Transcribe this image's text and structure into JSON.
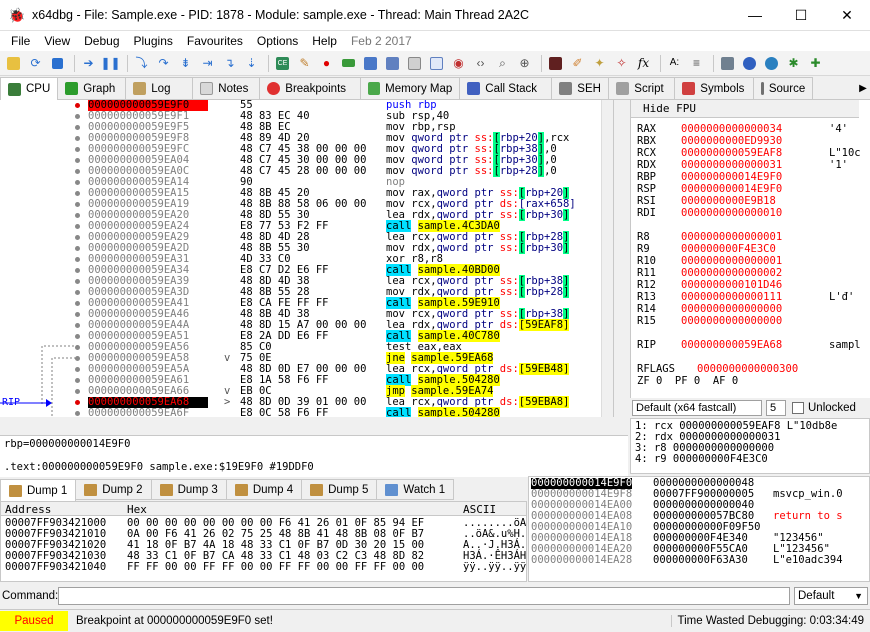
{
  "window": {
    "title": "x64dbg - File: Sample.exe - PID: 1878 - Module: sample.exe - Thread: Main Thread 2A2C",
    "minimize_glyph": "—",
    "maximize_glyph": "☐",
    "close_glyph": "✕"
  },
  "menu": {
    "items": [
      "File",
      "View",
      "Debug",
      "Plugins",
      "Favourites",
      "Options",
      "Help"
    ],
    "date": "Feb 2 2017"
  },
  "toolbar": {
    "icons": [
      "open-icon",
      "restart-icon",
      "close-file-icon",
      "run-icon",
      "pause-icon",
      "step-into-icon",
      "step-over-icon",
      "execute-till-return-icon",
      "run-to-user-code-icon",
      "trace-into-icon",
      "trace-over-icon",
      "scylla-icon",
      "patch-icon",
      "breakpoint-icon",
      "memory-icon",
      "stack-icon",
      "module-icon",
      "handles-icon",
      "comments-icon",
      "labels-icon",
      "find-icon",
      "calls-icon",
      "cpuid-icon",
      "highlight-icon",
      "edit-icon",
      "hardware-icon",
      "fx-icon",
      "font-icon",
      "calculator-icon",
      "help-icon",
      "globe-icon",
      "bug-icon",
      "puzzle-icon"
    ],
    "ce_label": "CE",
    "fx_label": "fx",
    "font_label": "A:"
  },
  "tabs": [
    {
      "label": "CPU",
      "active": true,
      "color": "#3a7d3a"
    },
    {
      "label": "Graph",
      "active": false,
      "color": "#2c9c2c"
    },
    {
      "label": "Log",
      "active": false,
      "color": "#c0a060"
    },
    {
      "label": "Notes",
      "active": false,
      "color": "#d8d8d8"
    },
    {
      "label": "Breakpoints",
      "active": false,
      "color": "#e03030"
    },
    {
      "label": "Memory Map",
      "active": false,
      "color": "#4aa84a"
    },
    {
      "label": "Call Stack",
      "active": false,
      "color": "#4060c0"
    },
    {
      "label": "SEH",
      "active": false,
      "color": "#808080"
    },
    {
      "label": "Script",
      "active": false,
      "color": "#a0a0a0"
    },
    {
      "label": "Symbols",
      "active": false,
      "color": "#d04040"
    },
    {
      "label": "Source",
      "active": false,
      "color": "#707070"
    }
  ],
  "disasm": [
    {
      "addr": "000000000059E9F0",
      "mark": "",
      "bytes": "55",
      "asm": [
        [
          "push rbp",
          "push"
        ]
      ],
      "style": "bp"
    },
    {
      "addr": "000000000059E9F1",
      "mark": "",
      "bytes": "48 83 EC 40",
      "asm": [
        [
          "sub rsp,40",
          ""
        ]
      ]
    },
    {
      "addr": "000000000059E9F5",
      "mark": "",
      "bytes": "48 8B EC",
      "asm": [
        [
          "mov rbp,rsp",
          ""
        ]
      ]
    },
    {
      "addr": "000000000059E9F8",
      "mark": "",
      "bytes": "48 89 4D 20",
      "asm": [
        [
          "mov ",
          ""
        ],
        [
          "qword ptr ",
          "mem"
        ],
        [
          "ss:",
          "seg"
        ],
        [
          "[",
          "reg"
        ],
        [
          "rbp+20",
          "mem"
        ],
        [
          "]",
          "reg"
        ],
        [
          ",rcx",
          ""
        ]
      ]
    },
    {
      "addr": "000000000059E9FC",
      "mark": "",
      "bytes": "48 C7 45 38 00 00 00",
      "asm": [
        [
          "mov ",
          ""
        ],
        [
          "qword ptr ",
          "mem"
        ],
        [
          "ss:",
          "seg"
        ],
        [
          "[",
          "reg"
        ],
        [
          "rbp+38",
          "mem"
        ],
        [
          "]",
          "reg"
        ],
        [
          ",0",
          ""
        ]
      ]
    },
    {
      "addr": "000000000059EA04",
      "mark": "",
      "bytes": "48 C7 45 30 00 00 00",
      "asm": [
        [
          "mov ",
          ""
        ],
        [
          "qword ptr ",
          "mem"
        ],
        [
          "ss:",
          "seg"
        ],
        [
          "[",
          "reg"
        ],
        [
          "rbp+30",
          "mem"
        ],
        [
          "]",
          "reg"
        ],
        [
          ",0",
          ""
        ]
      ]
    },
    {
      "addr": "000000000059EA0C",
      "mark": "",
      "bytes": "48 C7 45 28 00 00 00",
      "asm": [
        [
          "mov ",
          ""
        ],
        [
          "qword ptr ",
          "mem"
        ],
        [
          "ss:",
          "seg"
        ],
        [
          "[",
          "reg"
        ],
        [
          "rbp+28",
          "mem"
        ],
        [
          "]",
          "reg"
        ],
        [
          ",0",
          ""
        ]
      ]
    },
    {
      "addr": "000000000059EA14",
      "mark": "",
      "bytes": "90",
      "asm": [
        [
          "nop",
          "nop"
        ]
      ]
    },
    {
      "addr": "000000000059EA15",
      "mark": "",
      "bytes": "48 8B 45 20",
      "asm": [
        [
          "mov rax,",
          ""
        ],
        [
          "qword ptr ",
          "mem"
        ],
        [
          "ss:",
          "seg"
        ],
        [
          "[",
          "reg"
        ],
        [
          "rbp+20",
          "mem"
        ],
        [
          "]",
          "reg"
        ]
      ]
    },
    {
      "addr": "000000000059EA19",
      "mark": "",
      "bytes": "48 8B 88 58 06 00 00",
      "asm": [
        [
          "mov rcx,",
          ""
        ],
        [
          "qword ptr ",
          "mem"
        ],
        [
          "ds:",
          "seg"
        ],
        [
          "[rax+658]",
          "mem"
        ]
      ]
    },
    {
      "addr": "000000000059EA20",
      "mark": "",
      "bytes": "48 8D 55 30",
      "asm": [
        [
          "lea rdx,",
          ""
        ],
        [
          "qword ptr ",
          "mem"
        ],
        [
          "ss:",
          "seg"
        ],
        [
          "[",
          "reg"
        ],
        [
          "rbp+30",
          "mem"
        ],
        [
          "]",
          "reg"
        ]
      ]
    },
    {
      "addr": "000000000059EA24",
      "mark": "",
      "bytes": "E8 77 53 F2 FF",
      "asm": [
        [
          "call",
          "call"
        ],
        [
          " ",
          ""
        ],
        [
          "sample.4C3DA0",
          "jaddr"
        ]
      ]
    },
    {
      "addr": "000000000059EA29",
      "mark": "",
      "bytes": "48 8D 4D 28",
      "asm": [
        [
          "lea rcx,",
          ""
        ],
        [
          "qword ptr ",
          "mem"
        ],
        [
          "ss:",
          "seg"
        ],
        [
          "[",
          "reg"
        ],
        [
          "rbp+28",
          "mem"
        ],
        [
          "]",
          "reg"
        ]
      ]
    },
    {
      "addr": "000000000059EA2D",
      "mark": "",
      "bytes": "48 8B 55 30",
      "asm": [
        [
          "mov rdx,",
          ""
        ],
        [
          "qword ptr ",
          "mem"
        ],
        [
          "ss:",
          "seg"
        ],
        [
          "[",
          "reg"
        ],
        [
          "rbp+30",
          "mem"
        ],
        [
          "]",
          "reg"
        ]
      ]
    },
    {
      "addr": "000000000059EA31",
      "mark": "",
      "bytes": "4D 33 C0",
      "asm": [
        [
          "xor r8,r8",
          ""
        ]
      ]
    },
    {
      "addr": "000000000059EA34",
      "mark": "",
      "bytes": "E8 C7 D2 E6 FF",
      "asm": [
        [
          "call",
          "call"
        ],
        [
          " ",
          ""
        ],
        [
          "sample.40BD00",
          "jaddr"
        ]
      ]
    },
    {
      "addr": "000000000059EA39",
      "mark": "",
      "bytes": "48 8D 4D 38",
      "asm": [
        [
          "lea rcx,",
          ""
        ],
        [
          "qword ptr ",
          "mem"
        ],
        [
          "ss:",
          "seg"
        ],
        [
          "[",
          "reg"
        ],
        [
          "rbp+38",
          "mem"
        ],
        [
          "]",
          "reg"
        ]
      ]
    },
    {
      "addr": "000000000059EA3D",
      "mark": "",
      "bytes": "48 8B 55 28",
      "asm": [
        [
          "mov rdx,",
          ""
        ],
        [
          "qword ptr ",
          "mem"
        ],
        [
          "ss:",
          "seg"
        ],
        [
          "[",
          "reg"
        ],
        [
          "rbp+28",
          "mem"
        ],
        [
          "]",
          "reg"
        ]
      ]
    },
    {
      "addr": "000000000059EA41",
      "mark": "",
      "bytes": "E8 CA FE FF FF",
      "asm": [
        [
          "call",
          "call"
        ],
        [
          " ",
          ""
        ],
        [
          "sample.59E910",
          "jaddr"
        ]
      ]
    },
    {
      "addr": "000000000059EA46",
      "mark": "",
      "bytes": "48 8B 4D 38",
      "asm": [
        [
          "mov rcx,",
          ""
        ],
        [
          "qword ptr ",
          "mem"
        ],
        [
          "ss:",
          "seg"
        ],
        [
          "[",
          "reg"
        ],
        [
          "rbp+38",
          "mem"
        ],
        [
          "]",
          "reg"
        ]
      ]
    },
    {
      "addr": "000000000059EA4A",
      "mark": "",
      "bytes": "48 8D 15 A7 00 00 00",
      "asm": [
        [
          "lea rdx,",
          ""
        ],
        [
          "qword ptr ",
          "mem"
        ],
        [
          "ds:",
          "seg"
        ],
        [
          "[59EAF8]",
          "jaddr"
        ]
      ]
    },
    {
      "addr": "000000000059EA51",
      "mark": "",
      "bytes": "E8 2A DD E6 FF",
      "asm": [
        [
          "call",
          "call"
        ],
        [
          " ",
          ""
        ],
        [
          "sample.40C780",
          "jaddr"
        ]
      ]
    },
    {
      "addr": "000000000059EA56",
      "mark": "",
      "bytes": "85 C0",
      "asm": [
        [
          "test eax,eax",
          ""
        ]
      ]
    },
    {
      "addr": "000000000059EA58",
      "mark": "v",
      "bytes": "75 0E",
      "asm": [
        [
          "jne",
          "jmp"
        ],
        [
          " ",
          ""
        ],
        [
          "sample.59EA68",
          "jaddr"
        ]
      ]
    },
    {
      "addr": "000000000059EA5A",
      "mark": "",
      "bytes": "48 8D 0D E7 00 00 00",
      "asm": [
        [
          "lea rcx,",
          ""
        ],
        [
          "qword ptr ",
          "mem"
        ],
        [
          "ds:",
          "seg"
        ],
        [
          "[59EB48]",
          "jaddr"
        ]
      ]
    },
    {
      "addr": "000000000059EA61",
      "mark": "",
      "bytes": "E8 1A 58 F6 FF",
      "asm": [
        [
          "call",
          "call"
        ],
        [
          " ",
          ""
        ],
        [
          "sample.504280",
          "jaddr"
        ]
      ]
    },
    {
      "addr": "000000000059EA66",
      "mark": "v",
      "bytes": "EB 0C",
      "asm": [
        [
          "jmp",
          "jmp"
        ],
        [
          " ",
          ""
        ],
        [
          "sample.59EA74",
          "jaddr"
        ]
      ]
    },
    {
      "addr": "000000000059EA68",
      "mark": ">",
      "bytes": "48 8D 0D 39 01 00 00",
      "asm": [
        [
          "lea rcx,",
          ""
        ],
        [
          "qword ptr ",
          "mem"
        ],
        [
          "ds:",
          "seg"
        ],
        [
          "[59EBA8]",
          "jaddr"
        ]
      ],
      "style": "rip"
    },
    {
      "addr": "000000000059EA6F",
      "mark": "",
      "bytes": "E8 0C 58 F6 FF",
      "asm": [
        [
          "call",
          "call"
        ],
        [
          " ",
          ""
        ],
        [
          "sample.504280",
          "jaddr"
        ]
      ]
    }
  ],
  "rip_label": "RIP",
  "info": {
    "line1": "rbp=000000000014E9F0",
    "line2": ".text:000000000059E9F0 sample.exe:$19E9F0 #19DDF0"
  },
  "registers": {
    "hide_fpu": "Hide FPU",
    "rows": [
      {
        "name": "RAX",
        "value": "0000000000000034",
        "comment": "'4'"
      },
      {
        "name": "RBX",
        "value": "0000000000ED9930",
        "comment": ""
      },
      {
        "name": "RCX",
        "value": "000000000059EAF8",
        "comment": "L\"10c"
      },
      {
        "name": "RDX",
        "value": "0000000000000031",
        "comment": "'1'"
      },
      {
        "name": "RBP",
        "value": "000000000014E9F0",
        "comment": ""
      },
      {
        "name": "RSP",
        "value": "000000000014E9F0",
        "comment": ""
      },
      {
        "name": "RSI",
        "value": "0000000000E9B18",
        "comment": ""
      },
      {
        "name": "RDI",
        "value": "0000000000000010",
        "comment": ""
      },
      {
        "name": "",
        "value": "",
        "comment": ""
      },
      {
        "name": "R8",
        "value": "0000000000000001",
        "comment": ""
      },
      {
        "name": "R9",
        "value": "000000000F4E3C0",
        "comment": ""
      },
      {
        "name": "R10",
        "value": "0000000000000001",
        "comment": ""
      },
      {
        "name": "R11",
        "value": "0000000000000002",
        "comment": ""
      },
      {
        "name": "R12",
        "value": "0000000000101D46",
        "comment": ""
      },
      {
        "name": "R13",
        "value": "0000000000000111",
        "comment": "L'đ'"
      },
      {
        "name": "R14",
        "value": "0000000000000000",
        "comment": ""
      },
      {
        "name": "R15",
        "value": "0000000000000000",
        "comment": ""
      },
      {
        "name": "",
        "value": "",
        "comment": ""
      },
      {
        "name": "RIP",
        "value": "000000000059EA68",
        "comment": "sampl"
      },
      {
        "name": "",
        "value": "",
        "comment": ""
      },
      {
        "name": "RFLAGS",
        "value": "0000000000000300",
        "comment": ""
      },
      {
        "name": "ZF 0  PF 0  AF 0",
        "value": "",
        "comment": ""
      }
    ]
  },
  "callconv": {
    "convention": "Default (x64 fastcall)",
    "arg_count": "5",
    "unlocked_label": "Unlocked"
  },
  "args": [
    "1: rcx 000000000059EAF8 L\"10db8e",
    "2: rdx 0000000000000031",
    "3: r8 0000000000000000",
    "4: r9 000000000F4E3C0"
  ],
  "dump_tabs": [
    {
      "label": "Dump 1",
      "active": true
    },
    {
      "label": "Dump 2",
      "active": false
    },
    {
      "label": "Dump 3",
      "active": false
    },
    {
      "label": "Dump 4",
      "active": false
    },
    {
      "label": "Dump 5",
      "active": false
    },
    {
      "label": "Watch 1",
      "active": false
    }
  ],
  "dump": {
    "headers": {
      "address": "Address",
      "hex": "Hex",
      "ascii": "ASCII"
    },
    "rows": [
      {
        "addr": "00007FF903421000",
        "hex": "00 00 00 00 00 00 00 00 F6 41 26 01 0F 85 94 EF",
        "ascii": "........öA&....ï"
      },
      {
        "addr": "00007FF903421010",
        "hex": "0A 00 F6 41 26 02 75 25 48 8B 41 48 8B 08 0F B7",
        "ascii": "..öA&.u%H.AH...·"
      },
      {
        "addr": "00007FF903421020",
        "hex": "41 18 0F B7 4A 18 48 33 C1 0F B7 0D 30 20 15 00",
        "ascii": "A..·J.H3Á..·0 .."
      },
      {
        "addr": "00007FF903421030",
        "hex": "48 33 C1 0F B7 CA 48 33 C1 48 03 C2 C3 48 8D 82",
        "ascii": "H3Á.·ÊH3ÁH.ÂÃH.."
      },
      {
        "addr": "00007FF903421040",
        "hex": "FF FF 00 00 FF FF 00 00 FF FF 00 00 FF FF 00 00",
        "ascii": "ÿÿ..ÿÿ..ÿÿ..ÿÿ.."
      }
    ]
  },
  "stack": [
    {
      "addr": "000000000014E9F0",
      "value": "0000000000000048",
      "comment": "",
      "selected": true
    },
    {
      "addr": "000000000014E9F8",
      "value": "00007FF900000005",
      "comment": "msvcp_win.0"
    },
    {
      "addr": "000000000014EA00",
      "value": "0000000000000040",
      "comment": ""
    },
    {
      "addr": "000000000014EA08",
      "value": "000000000057BC80",
      "comment": "return to s"
    },
    {
      "addr": "000000000014EA10",
      "value": "00000000000F09F50",
      "comment": ""
    },
    {
      "addr": "000000000014EA18",
      "value": "000000000F4E340",
      "comment": "\"123456\""
    },
    {
      "addr": "000000000014EA20",
      "value": "000000000F55CA0",
      "comment": "L\"123456\""
    },
    {
      "addr": "000000000014EA28",
      "value": "000000000F63A30",
      "comment": "L\"e10adc394"
    }
  ],
  "command": {
    "label": "Command:",
    "default_label": "Default"
  },
  "status": {
    "state": "Paused",
    "message": "Breakpoint at 000000000059E9F0 set!",
    "time_wasted": "Time Wasted Debugging: 0:03:34:49"
  }
}
